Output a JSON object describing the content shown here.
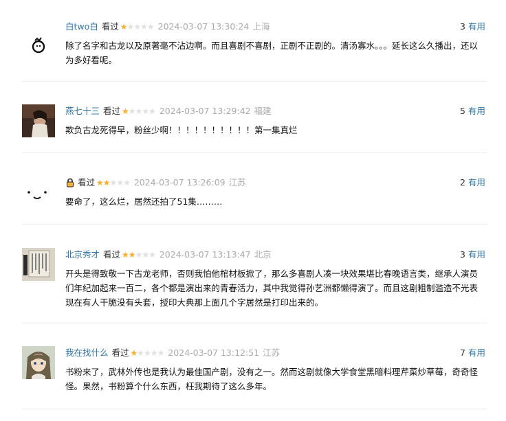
{
  "comments": [
    {
      "user": "白two白",
      "watched": "看过",
      "rating": 1,
      "time": "2024-03-07 13:30:24",
      "location": "上海",
      "useful_count": "3",
      "useful_label": "有用",
      "content": "除了名字和古龙以及原著毫不沾边啊。而且喜剧不喜剧，正剧不正剧的。清汤寡水。。。延长这么久播出，还以为多好看呢。"
    },
    {
      "user": "燕七十三",
      "watched": "看过",
      "rating": 1,
      "time": "2024-03-07 13:29:42",
      "location": "福建",
      "useful_count": "5",
      "useful_label": "有用",
      "content": "欺负古龙死得早，粉丝少啊！！！！！！！！！！第一集真烂"
    },
    {
      "user": "",
      "watched": "看过",
      "rating": 2,
      "time": "2024-03-07 13:26:09",
      "location": "江苏",
      "useful_count": "2",
      "useful_label": "有用",
      "content": "要命了，这么烂，居然还拍了51集………"
    },
    {
      "user": "北京秀才",
      "watched": "看过",
      "rating": 2,
      "time": "2024-03-07 13:13:47",
      "location": "北京",
      "useful_count": "3",
      "useful_label": "有用",
      "content": "开头是得致敬一下古龙老师，否则我怕他棺材板掀了，那么多喜剧人凑一块效果堪比春晚语言类，继承人演员们年纪加起来一百二，各个都是演出来的青春活力，其中我觉得孙艺洲都懒得演了。而且这剧粗制滥造不光表现在有人干脆没有头套，授印大典那上面几个字居然是打印出来的。"
    },
    {
      "user": "我在找什么",
      "watched": "看过",
      "rating": 1,
      "time": "2024-03-07 13:12:51",
      "location": "江苏",
      "useful_count": "7",
      "useful_label": "有用",
      "content": "书粉来了，武林外传也是我认为最佳国产剧，没有之一。然而这剧就像大学食堂黑暗料理芹菜炒草莓，奇奇怪怪。果然，书粉算个什么东西，枉我期待了这么多年。"
    }
  ],
  "colors": {
    "link": "#3377aa",
    "star": "#ffac2d",
    "meta": "#aaaaaa"
  },
  "icons": [
    "avatar-bag-icon",
    "avatar-photo",
    "avatar-face-icon",
    "avatar-photo",
    "avatar-anime",
    "lock-icon"
  ]
}
